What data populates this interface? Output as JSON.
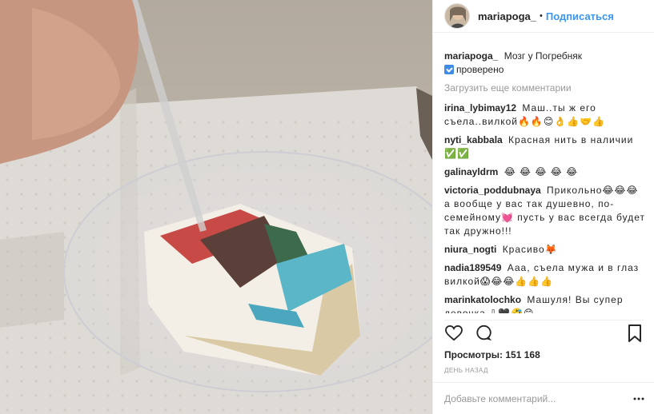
{
  "header": {
    "username": "mariapoga_",
    "separator": "•",
    "follow_label": "Подписаться"
  },
  "caption": {
    "username": "mariapoga_",
    "text": "Мозг у Погребняк",
    "line2": "проверено"
  },
  "load_more_label": "Загрузить еще комментарии",
  "comments": [
    {
      "user": "irina_lybimay12",
      "text": "Маш..ты ж его съела..вилкой🔥🔥😊👌👍🤝👍"
    },
    {
      "user": "nyti_kabbala",
      "text": "Красная нить в наличии ✅✅"
    },
    {
      "user": "galinayldrm",
      "text": "😂 😂 😂 😂 😂"
    },
    {
      "user": "victoria_poddubnaya",
      "text": "Прикольно😂😂😂 а вообще у вас так душевно, по-семейному💓 пусть у вас всегда будет так дружно!!!"
    },
    {
      "user": "niura_nogti",
      "text": "Красиво🦊"
    },
    {
      "user": "nadia189549",
      "text": "Ааа, съела мужа и в глаз вилкой😱😂😂👍👍👍"
    },
    {
      "user": "marinkatolochko",
      "text": "Машуля! Вы супер девочка ⇩🖤🤣😊"
    }
  ],
  "icons": {
    "like": "heart-icon",
    "comment": "comment-icon",
    "save": "bookmark-icon",
    "more": "more-dots-icon",
    "verified": "check-badge-icon"
  },
  "stats": {
    "views_label": "Просмотры:",
    "views_value": "151 168",
    "posted": "день назад"
  },
  "add_comment": {
    "placeholder": "Добавьте комментарий..."
  },
  "colors": {
    "link": "#3897f0",
    "muted": "#999999",
    "text": "#262626",
    "divider": "#efefef"
  }
}
